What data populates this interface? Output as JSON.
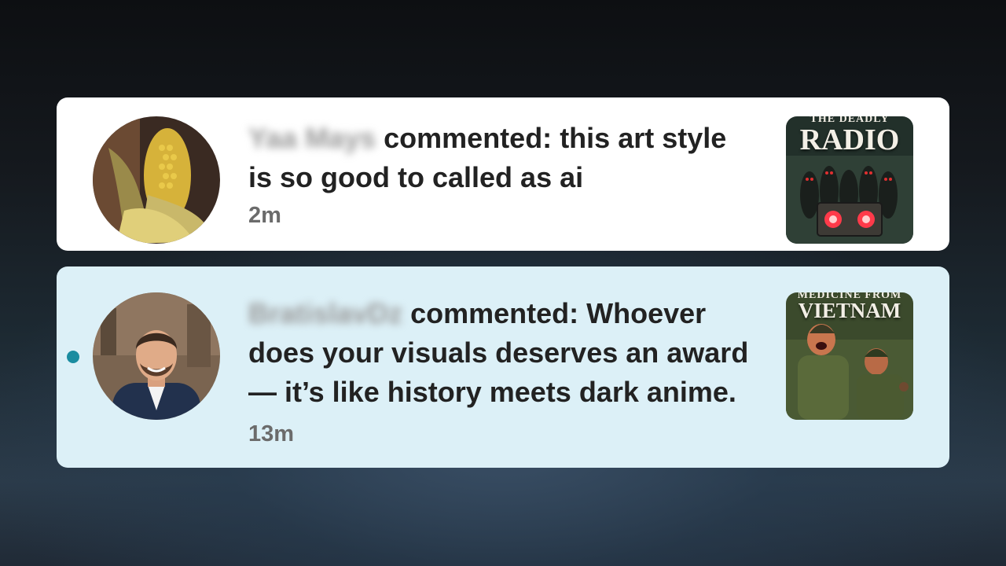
{
  "notifications": [
    {
      "user": "Yaa Mays",
      "action": "commented:",
      "comment": "this art style is so good to called as ai",
      "time": "2m",
      "unread": false,
      "avatar": "corn-icon",
      "thumbnail": {
        "kicker": "THE DEADLY",
        "title": "RADIO"
      }
    },
    {
      "user": "BratislavDz",
      "action": "commented:",
      "comment": "Whoever does your visuals deserves an award — it’s like history meets dark anime.",
      "time": "13m",
      "unread": true,
      "avatar": "person-photo",
      "thumbnail": {
        "kicker": "MEDICINE FROM",
        "title": "VIETNAM"
      }
    }
  ],
  "colors": {
    "read_card_bg": "#ffffff",
    "unread_card_bg": "#dcf0f7",
    "unread_dot": "#1a8ca0",
    "time_text": "#6b6b6b"
  }
}
